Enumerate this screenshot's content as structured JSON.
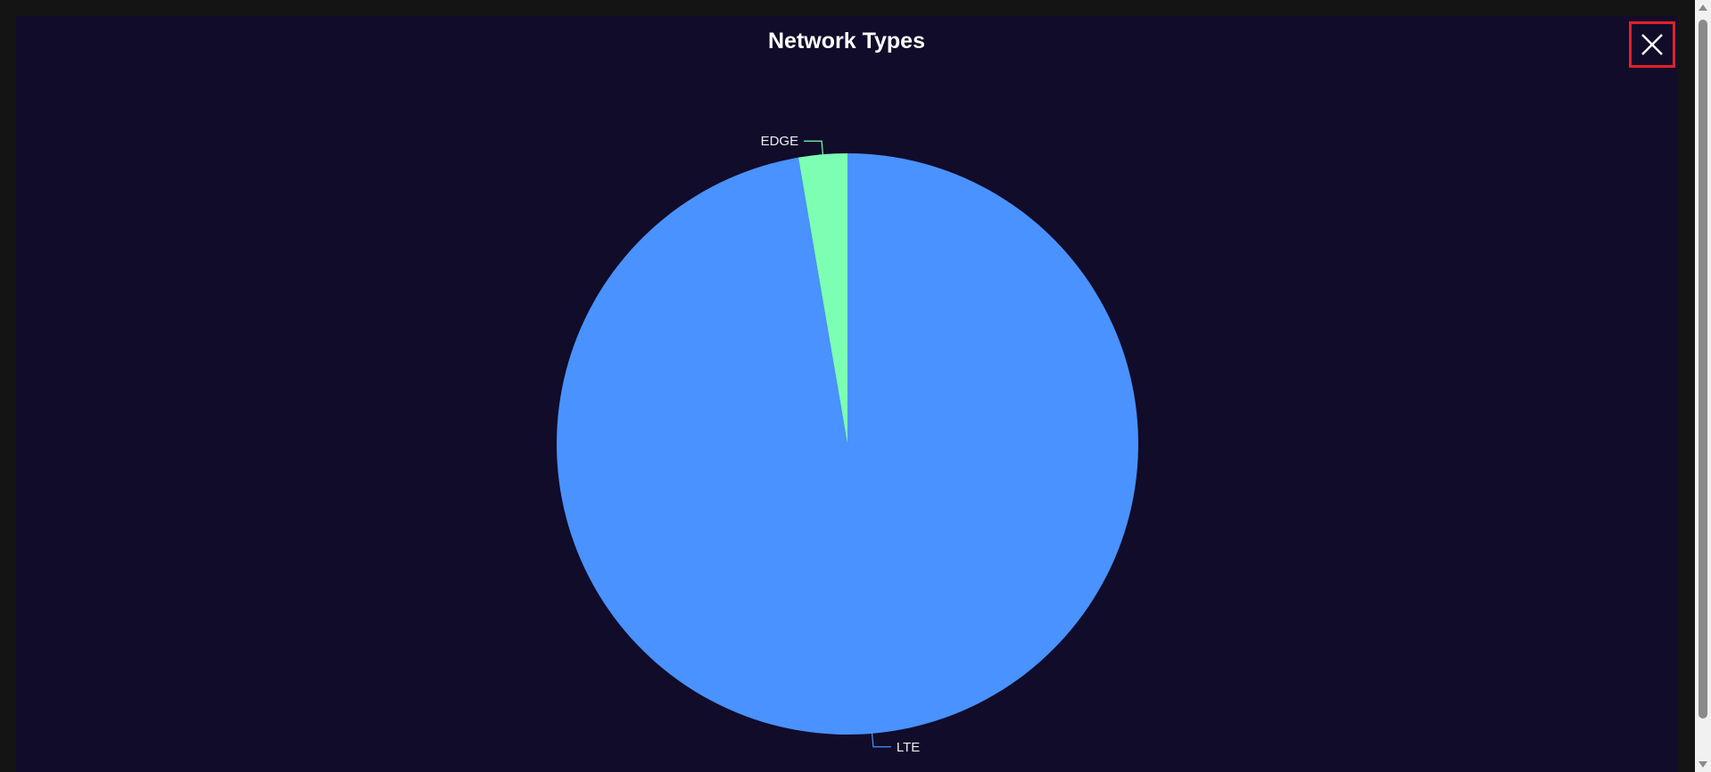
{
  "close_button": {
    "icon": "close-icon"
  },
  "chart_data": {
    "type": "pie",
    "title": "Network Types",
    "categories": [
      "LTE",
      "EDGE"
    ],
    "values": [
      97.3,
      2.7
    ],
    "colors": [
      "#4992ff",
      "#7cffb2"
    ],
    "label_color": "#eeeeee",
    "start_angle_deg": 90,
    "direction": "clockwise"
  }
}
